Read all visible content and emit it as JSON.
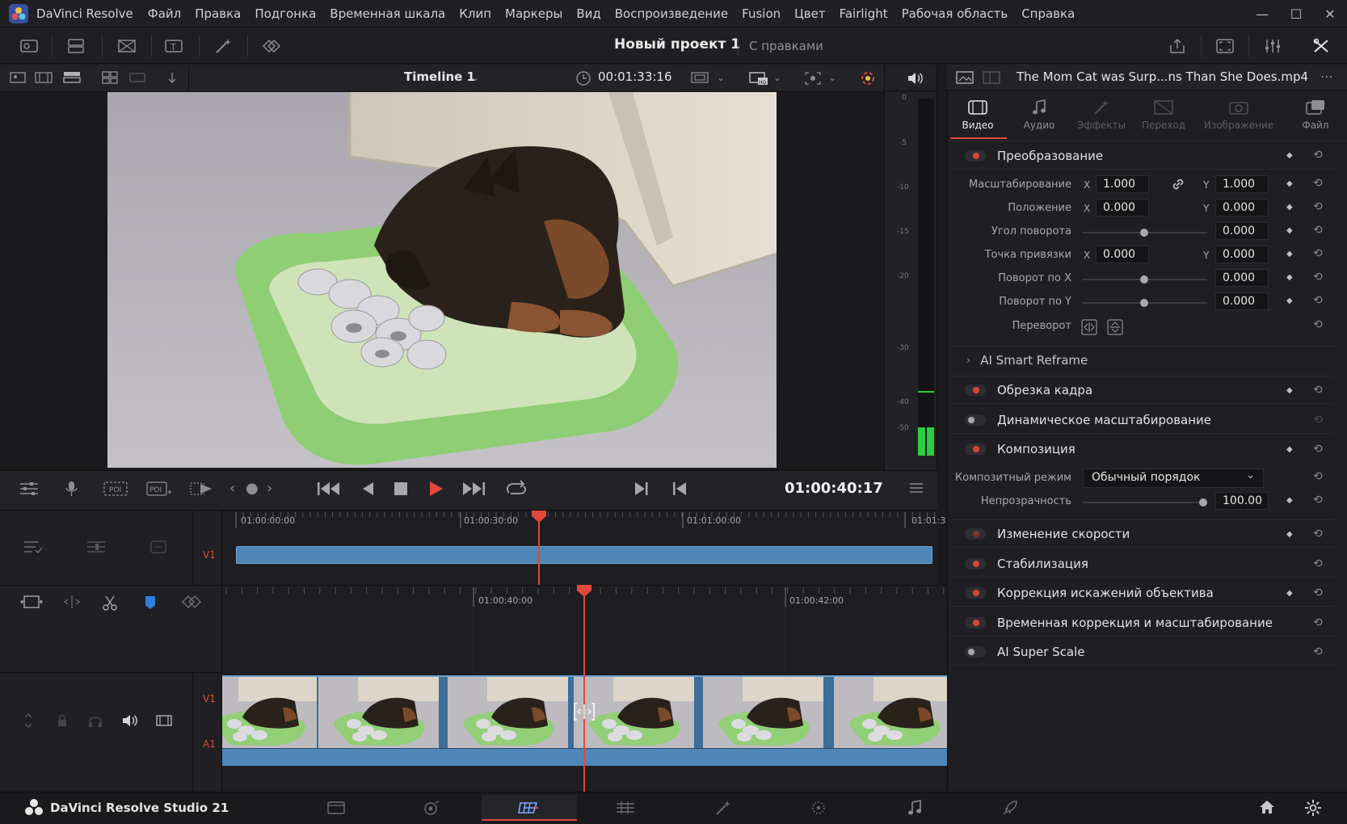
{
  "app": {
    "title": "DaVinci Resolve",
    "menu": [
      "Файл",
      "Правка",
      "Подгонка",
      "Временная шкала",
      "Клип",
      "Маркеры",
      "Вид",
      "Воспроизведение",
      "Fusion",
      "Цвет",
      "Fairlight",
      "Рабочая область",
      "Справка"
    ]
  },
  "toolbar": {
    "project_title": "Новый проект 1",
    "project_status": "С правками"
  },
  "viewer": {
    "timeline_name": "Timeline 1",
    "timecode": "00:01:33:16"
  },
  "meter": {
    "scale": [
      "0",
      "-5",
      "-10",
      "-15",
      "-20",
      "-30",
      "-40",
      "-50"
    ],
    "level": 0.08
  },
  "transport": {
    "timecode": "01:00:40:17"
  },
  "timeline": {
    "upper_ruler": [
      "01:00:00:00",
      "01:00:30:00",
      "01:01:00:00",
      "01:01:3"
    ],
    "lower_ruler": [
      "01:00:40:00",
      "01:00:42:00"
    ],
    "tracks": {
      "v1": "V1",
      "a1": "A1"
    }
  },
  "inspector": {
    "file_name": "The Mom Cat was Surp...ns Than She Does.mp4",
    "tabs": [
      "Видео",
      "Аудио",
      "Эффекты",
      "Переход",
      "Изображение",
      "Файл"
    ],
    "transform": {
      "title": "Преобразование",
      "zoom_label": "Масштабирование",
      "zoom_x": "1.000",
      "zoom_y": "1.000",
      "position_label": "Положение",
      "position_x": "0.000",
      "position_y": "0.000",
      "rotation_label": "Угол поворота",
      "rotation": "0.000",
      "anchor_label": "Точка привязки",
      "anchor_x": "0.000",
      "anchor_y": "0.000",
      "pitch_label": "Поворот по X",
      "pitch": "0.000",
      "yaw_label": "Поворот по Y",
      "yaw": "0.000",
      "flip_label": "Переворот",
      "x": "X",
      "y": "Y"
    },
    "smart_reframe": "AI Smart Reframe",
    "cropping": "Обрезка кадра",
    "dynamic_zoom": "Динамическое масштабирование",
    "composite": {
      "title": "Композиция",
      "mode_label": "Композитный режим",
      "mode_value": "Обычный порядок",
      "opacity_label": "Непрозрачность",
      "opacity": "100.00"
    },
    "speed_change": "Изменение скорости",
    "stabilization": "Стабилизация",
    "lens_correction": "Коррекция искажений объектива",
    "retime_scaling": "Временная коррекция и масштабирование",
    "super_scale": "AI Super Scale"
  },
  "bottom": {
    "studio_label": "DaVinci Resolve Studio 21"
  },
  "colors": {
    "accent_red": "#e2483b",
    "clip_blue": "#4f86b8",
    "meter_green": "#2ecc40"
  }
}
